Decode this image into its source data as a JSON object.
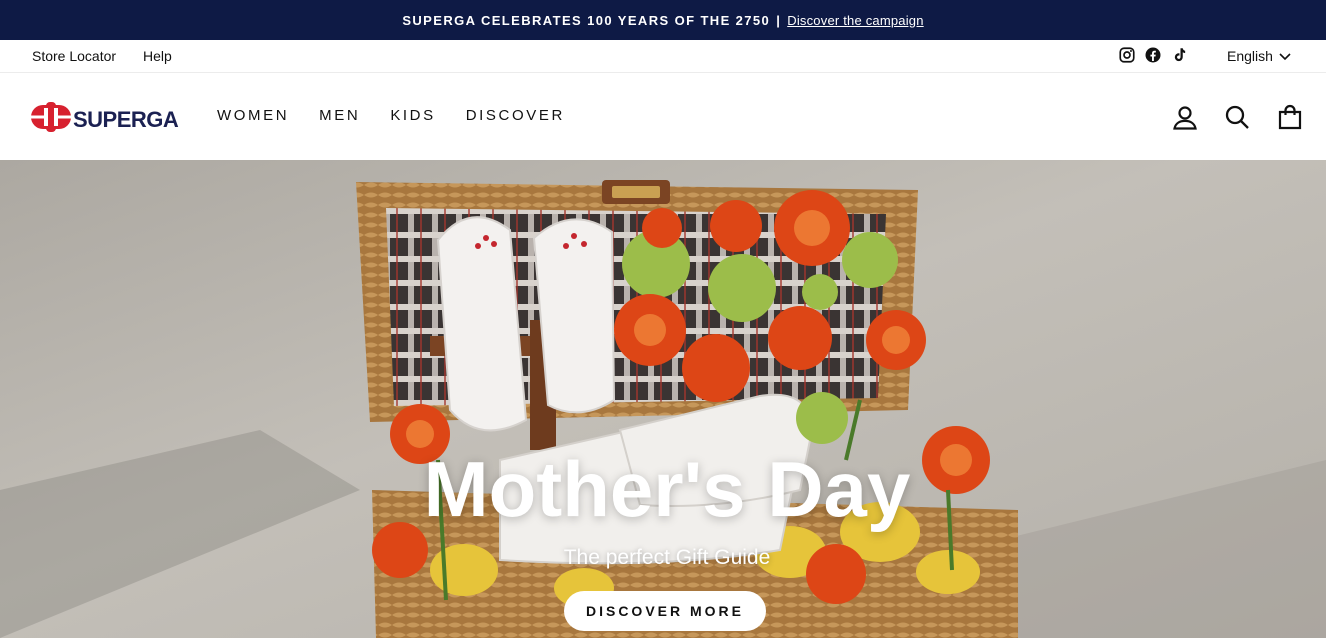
{
  "announcement": {
    "text": "SUPERGA CELEBRATES 100 YEARS OF THE 2750",
    "separator": "|",
    "link": "Discover the campaign"
  },
  "utility": {
    "links": [
      "Store Locator",
      "Help"
    ],
    "social_icons": [
      "instagram-icon",
      "facebook-icon",
      "tiktok-icon"
    ],
    "language": "English"
  },
  "header": {
    "logo_text": "SUPERGA",
    "nav": [
      "WOMEN",
      "MEN",
      "KIDS",
      "DISCOVER"
    ],
    "icons": [
      "account-icon",
      "search-icon",
      "cart-icon"
    ]
  },
  "hero": {
    "title": "Mother's Day",
    "subtitle": "The perfect Gift Guide",
    "button": "DISCOVER MORE"
  },
  "colors": {
    "announcement_bg": "#0e1a45",
    "logo_red": "#d7212f",
    "logo_navy": "#1b2152"
  }
}
